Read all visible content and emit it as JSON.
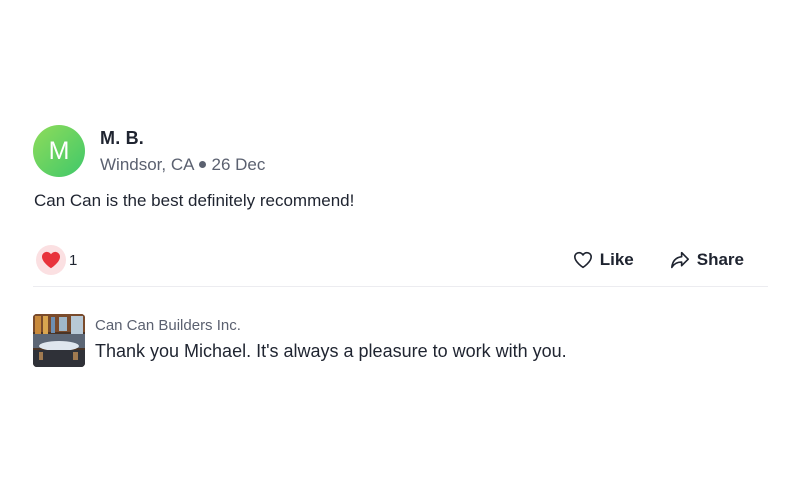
{
  "review": {
    "avatar_initial": "M",
    "author_name": "M. B.",
    "location": "Windsor, CA",
    "date": "26 Dec",
    "text": "Can Can is the best definitely recommend!"
  },
  "reactions": {
    "count": "1"
  },
  "actions": {
    "like_label": "Like",
    "share_label": "Share"
  },
  "reply": {
    "business_name": "Can Can Builders Inc.",
    "text": "Thank you Michael. It's always a pleasure to work with you."
  },
  "colors": {
    "avatar_gradient_start": "#8fdc5a",
    "avatar_gradient_end": "#3fc86a",
    "heart": "#e8333c",
    "reaction_bg": "#fbe0e2",
    "text_primary": "#1f2430",
    "text_secondary": "#5b6170"
  }
}
